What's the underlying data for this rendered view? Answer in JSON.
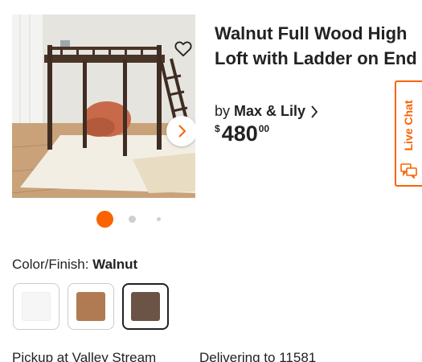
{
  "product": {
    "title": "Walnut Full Wood High Loft with Ladder on End",
    "by_label": "by",
    "brand": "Max & Lily",
    "price": {
      "currency": "$",
      "dollars": "480",
      "cents": "00"
    }
  },
  "gallery": {
    "total_images": 3,
    "active_index": 0
  },
  "live_chat": {
    "label": "Live Chat"
  },
  "color": {
    "label": "Color/Finish:",
    "selected": "Walnut",
    "swatches": [
      {
        "name": "White",
        "color": "#f6f6f6",
        "selected": false
      },
      {
        "name": "Chestnut",
        "color": "#b07b52",
        "selected": false
      },
      {
        "name": "Walnut",
        "color": "#6b5445",
        "selected": true
      }
    ]
  },
  "fulfillment": {
    "pickup": "Pickup at Valley Stream",
    "delivery": "Delivering to 11581"
  },
  "colors": {
    "accent": "#f96302",
    "text": "#222222",
    "dot_inactive": "#cfcfcf"
  },
  "icons": {
    "favorite": "heart-outline-icon",
    "next": "chevron-right-icon",
    "brand_link": "chevron-right-icon",
    "chat": "chat-bubbles-icon"
  }
}
